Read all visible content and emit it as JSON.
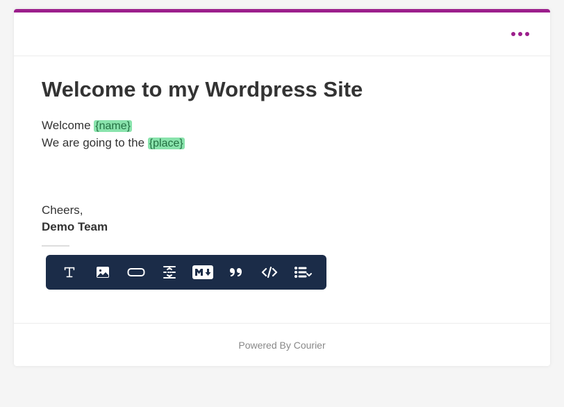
{
  "title": "Welcome to my Wordpress Site",
  "body": {
    "line1_prefix": "Welcome ",
    "line1_var": "{name}",
    "line2_prefix": "We are going to the ",
    "line2_var": "{place}"
  },
  "signature": {
    "closing": "Cheers,",
    "team": "Demo Team"
  },
  "toolbar": {
    "tools": [
      "text",
      "image",
      "button",
      "divider",
      "markdown",
      "quote",
      "code",
      "list"
    ]
  },
  "footer": "Powered By Courier",
  "colors": {
    "accent": "#9c1f8c",
    "toolbar_bg": "#1b2c48",
    "placeholder_bg": "#89e3ac",
    "placeholder_fg": "#247043"
  }
}
